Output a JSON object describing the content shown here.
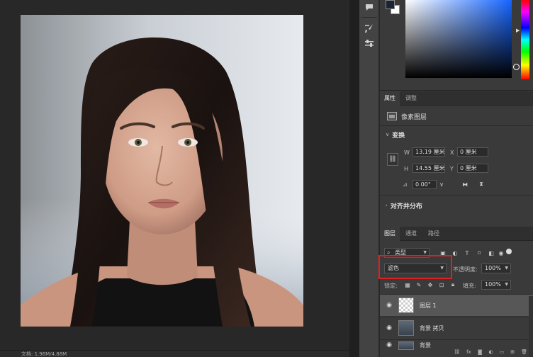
{
  "status": {
    "text": "文档: 1.96M/4.88M"
  },
  "colors": {
    "foreground": "#1b2433",
    "background": "#ffffff",
    "selection_outline": "#e02020"
  },
  "tools": [
    {
      "name": "comment-icon",
      "glyph": "▆"
    },
    {
      "name": "brush-settings-icon",
      "glyph": "✎"
    },
    {
      "name": "adjust-icon",
      "glyph": "⇌"
    }
  ],
  "properties": {
    "tabs": [
      "属性",
      "调整"
    ],
    "layer_type": "像素图层",
    "transform_title": "变换",
    "w_label": "W",
    "w_value": "13.19 厘米",
    "x_label": "X",
    "x_value": "0 厘米",
    "h_label": "H",
    "h_value": "14.55 厘米",
    "y_label": "Y",
    "y_value": "0 厘米",
    "angle_value": "0.00°",
    "align_title": "对齐并分布"
  },
  "layers": {
    "tabs": [
      "图层",
      "通道",
      "路径"
    ],
    "filter_kind": "类型",
    "blend_mode": "滤色",
    "opacity_label": "不透明度:",
    "opacity_value": "100%",
    "lock_label": "锁定:",
    "fill_label": "填充:",
    "fill_value": "100%",
    "items": [
      {
        "name": "图层 1",
        "selected": true
      },
      {
        "name": "背景 拷贝",
        "selected": false
      },
      {
        "name": "背景",
        "selected": false
      }
    ]
  }
}
